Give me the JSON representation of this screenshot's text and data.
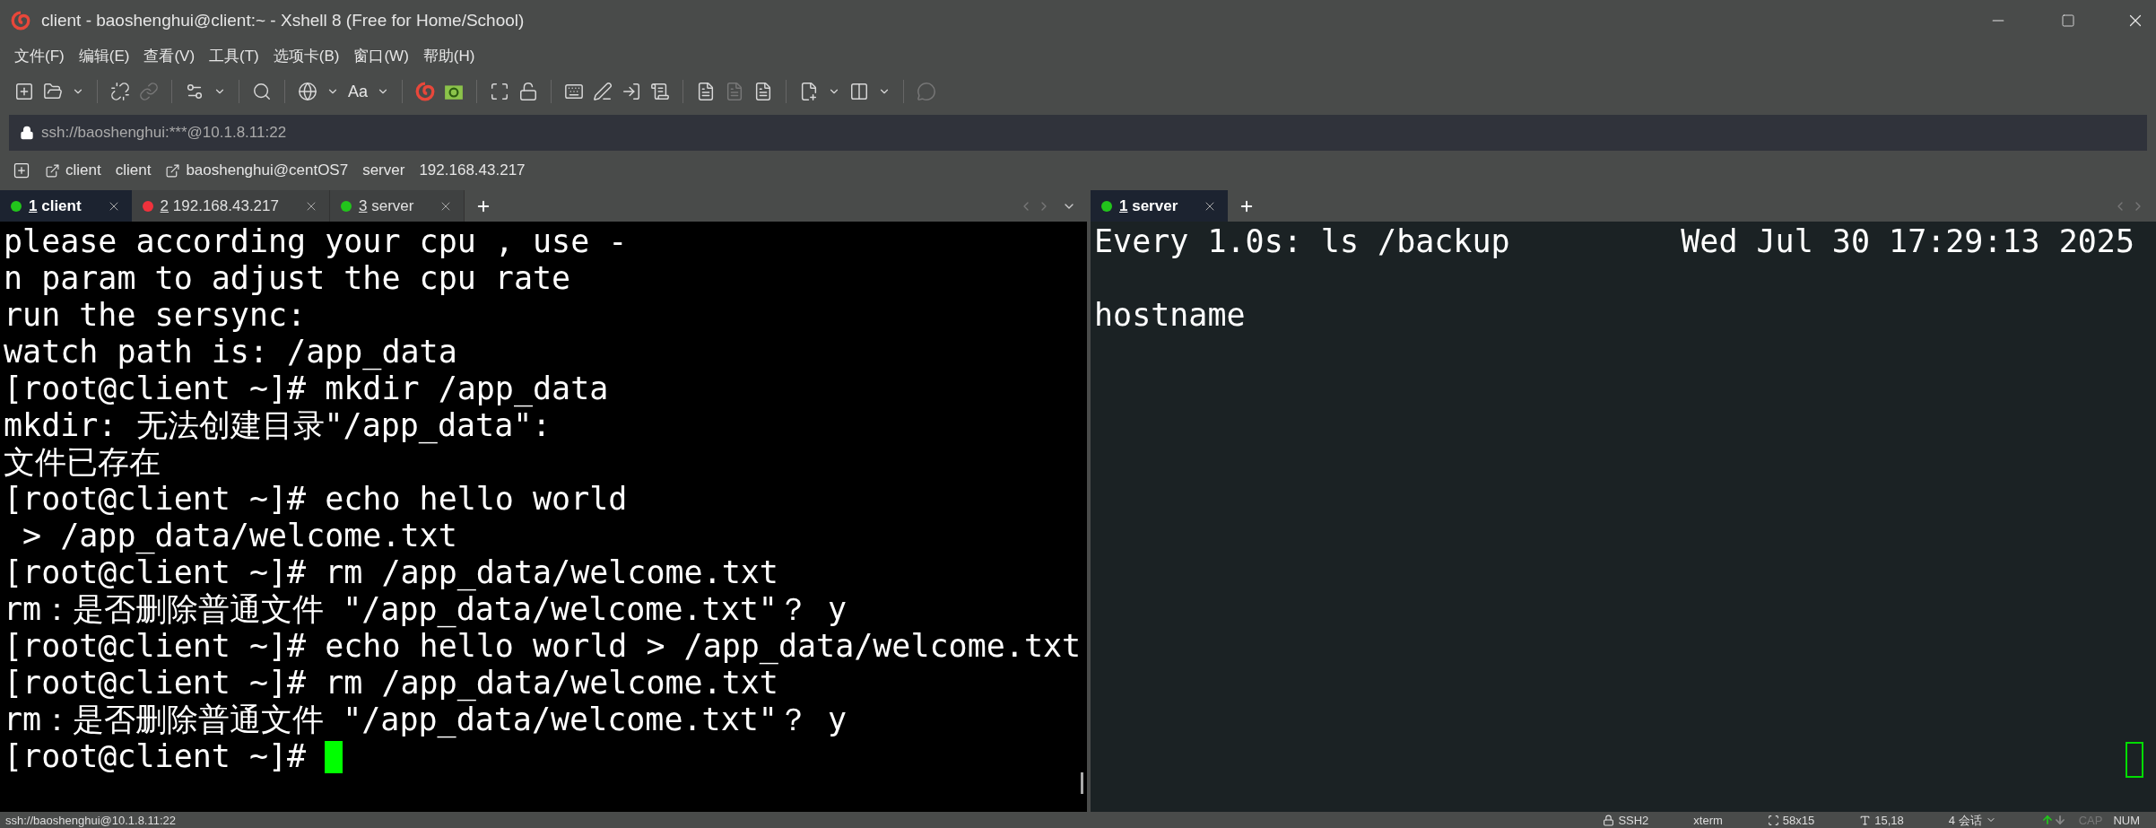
{
  "window": {
    "title": "client - baoshenghui@client:~ - Xshell 8 (Free for Home/School)"
  },
  "menu": [
    "文件(F)",
    "编辑(E)",
    "查看(V)",
    "工具(T)",
    "选项卡(B)",
    "窗口(W)",
    "帮助(H)"
  ],
  "toolbar": {
    "font_button": "Aa"
  },
  "address_bar": {
    "text": "ssh://baoshenghui:***@10.1.8.11:22"
  },
  "session_bar": [
    {
      "text": "client",
      "kind": "link"
    },
    {
      "text": "client",
      "kind": "plain"
    },
    {
      "text": "baoshenghui@centOS7",
      "kind": "link"
    },
    {
      "text": "server",
      "kind": "plain"
    },
    {
      "text": "192.168.43.217",
      "kind": "plain"
    }
  ],
  "panes": [
    {
      "focused": true,
      "tabs": [
        {
          "number": "1",
          "label": "client",
          "color": "#22c41c",
          "selected": true
        },
        {
          "number": "2",
          "label": "192.168.43.217",
          "color": "#f0323c",
          "selected": false
        },
        {
          "number": "3",
          "label": "server",
          "color": "#22c41c",
          "selected": false
        }
      ],
      "lines": [
        "please according your cpu , use -",
        "n param to adjust the cpu rate",
        "run the sersync:",
        "watch path is: /app_data",
        "[root@client ~]# mkdir /app_data",
        "mkdir: 无法创建目录\"/app_data\":",
        "文件已存在",
        "[root@client ~]# echo hello world",
        " > /app_data/welcome.txt",
        "[root@client ~]# rm /app_data/welcome.txt",
        "rm：是否删除普通文件 \"/app_data/welcome.txt\"？ y",
        "[root@client ~]# echo hello world > /app_data/welcome.txt",
        "[root@client ~]# rm /app_data/welcome.txt",
        "rm：是否删除普通文件 \"/app_data/welcome.txt\"？ y",
        "[root@client ~]# "
      ]
    },
    {
      "focused": false,
      "tabs": [
        {
          "number": "1",
          "label": "server",
          "color": "#22c41c",
          "selected": true
        }
      ],
      "header": {
        "command": "Every 1.0s: ls /backup",
        "time": "Wed Jul 30 17:29:13 2025"
      },
      "lines": [
        "hostname"
      ]
    }
  ],
  "status_bar": {
    "connection": "ssh://baoshenghui@10.1.8.11:22",
    "items": [
      {
        "text": "SSH2",
        "kind": "lock"
      },
      {
        "text": "xterm",
        "kind": "plain"
      },
      {
        "text": "58x15",
        "kind": "size"
      },
      {
        "text": "15,18",
        "kind": "cursor"
      },
      {
        "text": "4 会话",
        "kind": "sessions"
      }
    ],
    "toggles": [
      {
        "text": "CAP",
        "on": false
      },
      {
        "text": "NUM",
        "on": true
      }
    ]
  }
}
